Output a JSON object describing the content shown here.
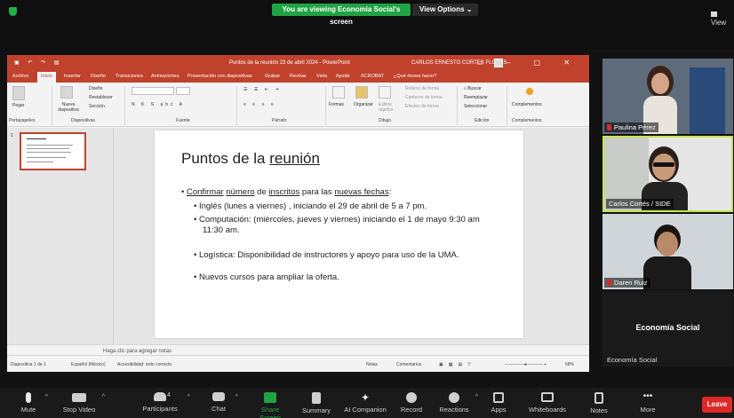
{
  "zoom_top": {
    "banner": "You are viewing Economía Social's screen",
    "view_options": "View Options",
    "view_label": "View"
  },
  "ppt": {
    "document_title": "Puntos de la reunión 23 de abril 2024  -  PowerPoint",
    "user_name": "CARLOS ERNESTO CORTES FLORES",
    "menu": [
      "Archivo",
      "Inicio",
      "Insertar",
      "Diseño",
      "Transiciones",
      "Animaciones",
      "Presentación con diapositivas",
      "Grabar",
      "Revisar",
      "Vista",
      "Ayuda",
      "ACROBAT",
      "¿Qué desea hacer?"
    ],
    "ribbon": {
      "pegar": "Pegar",
      "portapapeles": "Portapapeles",
      "nueva_diapositiva": "Nueva diapositiva",
      "diseno": "Diseño",
      "restablecer": "Restablecer",
      "seccion": "Sección",
      "diapositivas": "Diapositivas",
      "fuente": "Fuente",
      "parrafo": "Párrafo",
      "formas": "Formas",
      "organizar": "Organizar",
      "estilos_rapidos": "Estilos rápidos",
      "relleno": "Relleno de forma",
      "contorno": "Contorno de forma",
      "efectos": "Efectos de forma",
      "dibujo": "Dibujo",
      "buscar": "Buscar",
      "reemplazar": "Reemplazar",
      "seleccionar": "Seleccionar",
      "edicion": "Edición",
      "complementos_btn": "Complementos",
      "complementos_group": "Complementos"
    },
    "thumb_number": "1",
    "slide": {
      "title_pre": "Puntos de la ",
      "title_underlined": "reunión",
      "bullet1_a": "Confirmar",
      "bullet1_b": "número",
      "bullet1_c": "inscritos",
      "bullet1_d": "nuevas fechas",
      "bullet1_de": "de",
      "bullet1_para": "para las",
      "bullet1_colon": ":",
      "sub1": "Inglés (lunes a viernes) , iniciando el 29 de abril de 5 a 7 pm.",
      "sub2_line1": "Computación: (miércoles, jueves y viernes) iniciando el 1 de mayo 9:30 am",
      "sub2_line2": "11:30 am.",
      "sub3": "Logística: Disponibilidad de instructores y apoyo para uso de la UMA.",
      "sub4": "Nuevos cursos para ampliar la oferta."
    },
    "notes_placeholder": "Haga clic para agregar notas",
    "status": {
      "slide_count": "Diapositiva 1 de 1",
      "language": "Español (México)",
      "accessibility": "Accesibilidad: todo correcto",
      "notas": "Notas",
      "comentarios": "Comentarios",
      "zoom": "68%"
    }
  },
  "participants": [
    {
      "name": "Paulina Pérez",
      "muted": true
    },
    {
      "name": "Carlos Cortés / SIDE",
      "muted": false,
      "active_speaker": true
    },
    {
      "name": "Daren Ruiz",
      "muted": true
    },
    {
      "name": "Economía Social",
      "display": "Economía Social"
    }
  ],
  "toolbar": {
    "mute": "Mute",
    "stop_video": "Stop Video",
    "participants": "Participants",
    "participants_count": "4",
    "chat": "Chat",
    "share_screen": "Share Screen",
    "summary": "Summary",
    "ai_companion": "AI Companion",
    "record": "Record",
    "reactions": "Reactions",
    "apps": "Apps",
    "whiteboards": "Whiteboards",
    "notes": "Notes",
    "more": "More",
    "leave": "Leave"
  },
  "colors": {
    "ppt_accent": "#c0422d",
    "zoom_green": "#20a443",
    "leave_red": "#e02828",
    "active_speaker_border": "#c8e34f"
  }
}
